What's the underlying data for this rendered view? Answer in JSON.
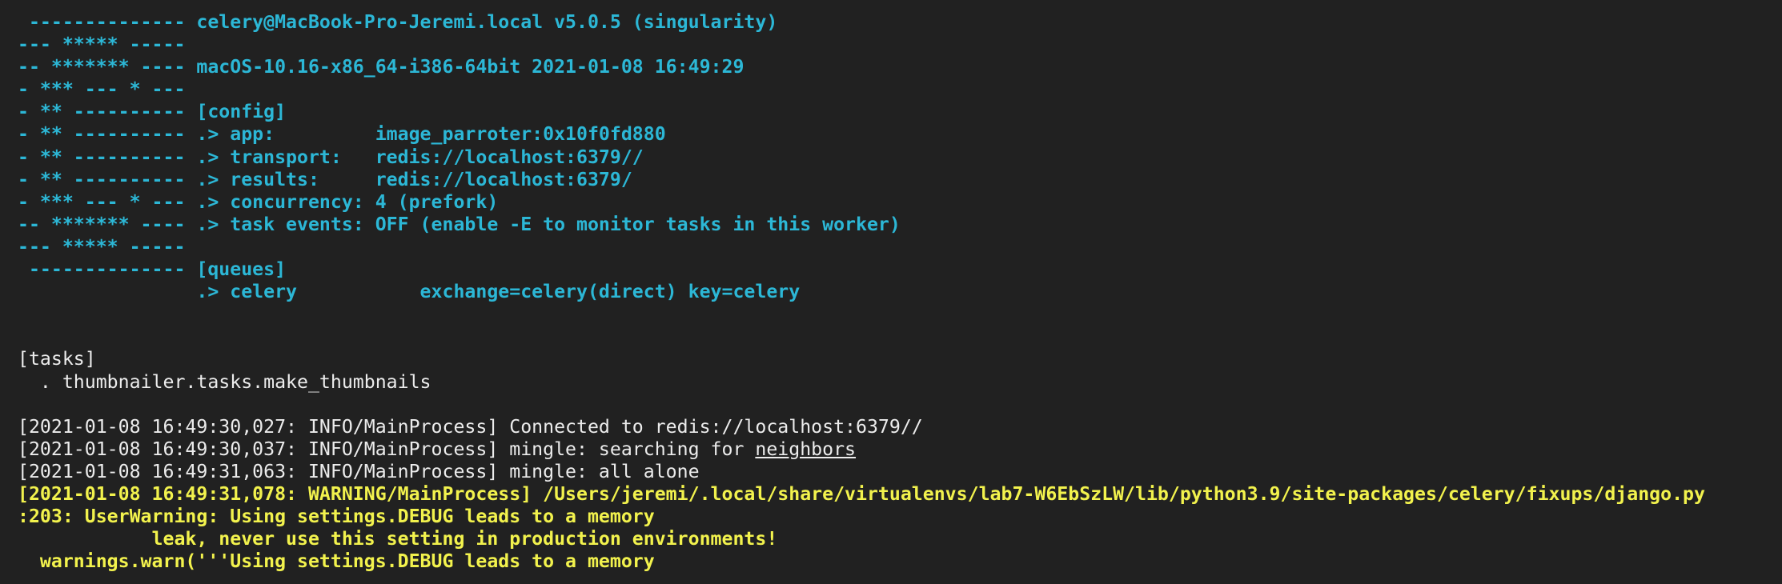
{
  "colors": {
    "background": "#212121",
    "banner_cyan": "#2cb7d6",
    "log_white": "#ececec",
    "warning_yellow": "#f2f24d"
  },
  "lines": [
    {
      "style": "cyan",
      "text": " -------------- celery@MacBook-Pro-Jeremi.local v5.0.5 (singularity)"
    },
    {
      "style": "cyan",
      "text": "--- ***** -----"
    },
    {
      "style": "cyan",
      "text": "-- ******* ---- macOS-10.16-x86_64-i386-64bit 2021-01-08 16:49:29"
    },
    {
      "style": "cyan",
      "text": "- *** --- * ---"
    },
    {
      "style": "cyan",
      "text": "- ** ---------- [config]"
    },
    {
      "style": "cyan",
      "text": "- ** ---------- .> app:         image_parroter:0x10f0fd880"
    },
    {
      "style": "cyan",
      "text": "- ** ---------- .> transport:   redis://localhost:6379//"
    },
    {
      "style": "cyan",
      "text": "- ** ---------- .> results:     redis://localhost:6379/"
    },
    {
      "style": "cyan",
      "text": "- *** --- * --- .> concurrency: 4 (prefork)"
    },
    {
      "style": "cyan",
      "text": "-- ******* ---- .> task events: OFF (enable -E to monitor tasks in this worker)"
    },
    {
      "style": "cyan",
      "text": "--- ***** -----"
    },
    {
      "style": "cyan",
      "text": " -------------- [queues]"
    },
    {
      "style": "cyan",
      "text": "                .> celery           exchange=celery(direct) key=celery"
    },
    {
      "style": "cyan",
      "text": ""
    },
    {
      "style": "cyan",
      "text": ""
    },
    {
      "style": "white",
      "text": "[tasks]"
    },
    {
      "style": "white",
      "text": "  . thumbnailer.tasks.make_thumbnails"
    },
    {
      "style": "white",
      "text": ""
    },
    {
      "style": "white",
      "text": "[2021-01-08 16:49:30,027: INFO/MainProcess] Connected to redis://localhost:6379//"
    },
    {
      "style": "white",
      "text": "[2021-01-08 16:49:30,037: INFO/MainProcess] mingle: searching for ",
      "underlined": "neighbors"
    },
    {
      "style": "white",
      "text": "[2021-01-08 16:49:31,063: INFO/MainProcess] mingle: all alone"
    },
    {
      "style": "yellow",
      "text": "[2021-01-08 16:49:31,078: WARNING/MainProcess] /Users/jeremi/.local/share/virtualenvs/lab7-W6EbSzLW/lib/python3.9/site-packages/celery/fixups/django.py"
    },
    {
      "style": "yellow",
      "text": ":203: UserWarning: Using settings.DEBUG leads to a memory"
    },
    {
      "style": "yellow",
      "text": "            leak, never use this setting in production environments!"
    },
    {
      "style": "yellow",
      "text": "  warnings.warn('''Using settings.DEBUG leads to a memory"
    }
  ]
}
